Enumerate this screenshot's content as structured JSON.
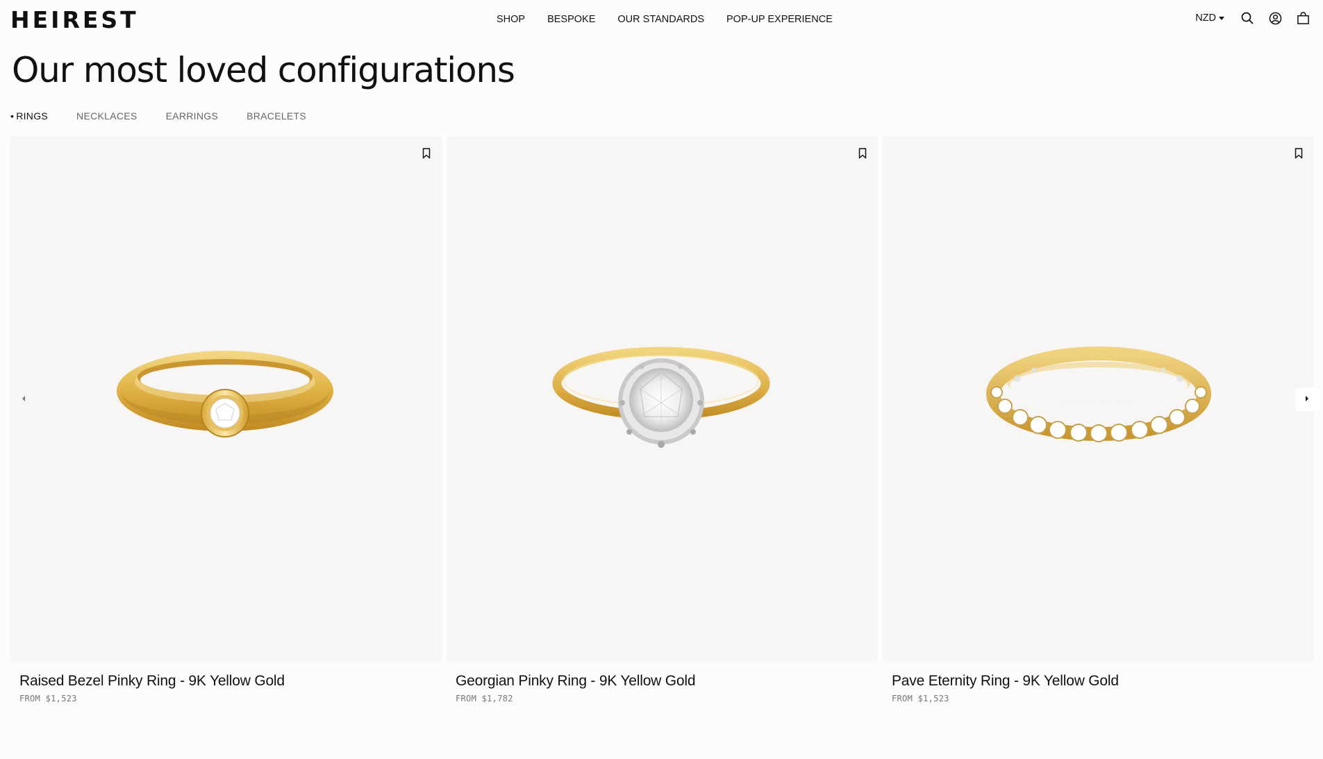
{
  "header": {
    "logo": "HEIREST",
    "nav": [
      "SHOP",
      "BESPOKE",
      "OUR STANDARDS",
      "POP-UP EXPERIENCE"
    ],
    "currency": "NZD",
    "icons": [
      "search-icon",
      "account-icon",
      "bag-icon"
    ]
  },
  "section": {
    "title": "Our most loved configurations",
    "tabs": [
      "RINGS",
      "NECKLACES",
      "EARRINGS",
      "BRACELETS"
    ],
    "active_tab": "RINGS"
  },
  "products": [
    {
      "name": "Raised Bezel Pinky Ring - 9K Yellow Gold",
      "price": "FROM $1,523"
    },
    {
      "name": "Georgian Pinky Ring - 9K Yellow Gold",
      "price": "FROM $1,782"
    },
    {
      "name": "Pave Eternity Ring - 9K Yellow Gold",
      "price": "FROM $1,523"
    }
  ],
  "carousel": {
    "prev_icon": "chevron-left-icon",
    "next_icon": "chevron-right-icon"
  },
  "colors": {
    "background": "#fdfcfb",
    "card_bg": "#f7f6f5",
    "gold": "#e4b84a",
    "text": "#111111"
  }
}
